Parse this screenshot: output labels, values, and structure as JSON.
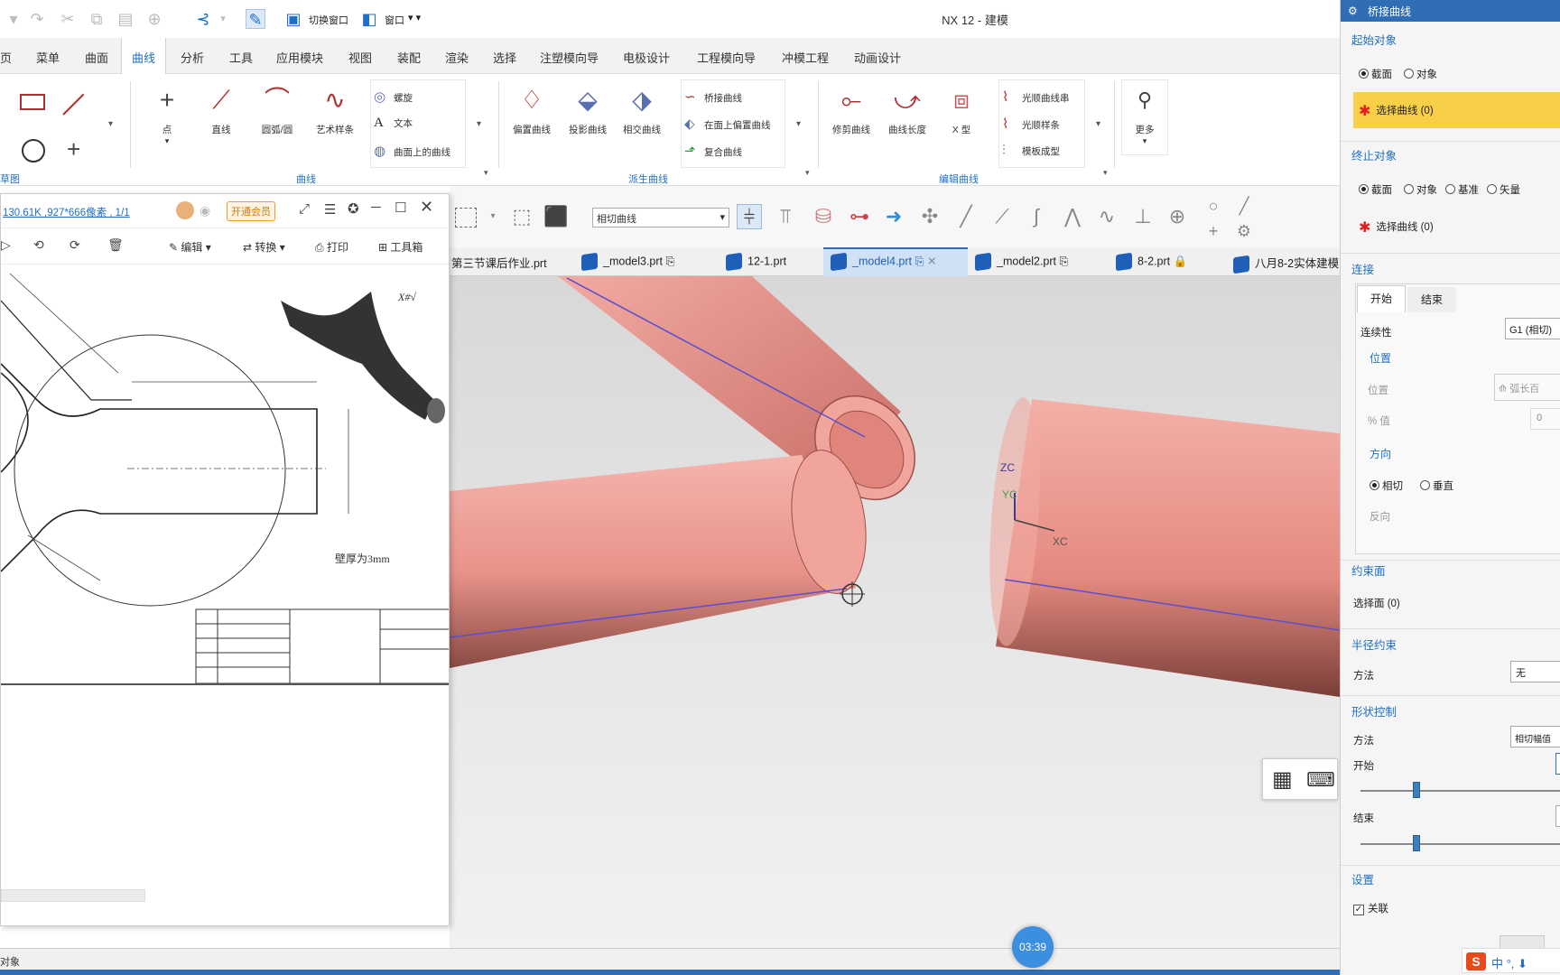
{
  "app": {
    "title": "NX 12 - 建模"
  },
  "quick_access": {
    "switch_window": "切换窗口",
    "window": "窗口"
  },
  "menu_tabs": [
    "页",
    "菜单",
    "曲面",
    "曲线",
    "分析",
    "工具",
    "应用模块",
    "视图",
    "装配",
    "渲染",
    "选择",
    "注塑模向导",
    "电极设计",
    "工程模向导",
    "冲模工程",
    "动画设计"
  ],
  "active_menu_tab": "曲线",
  "ribbon": {
    "group_sketch": "草图",
    "group_curve": "曲线",
    "group_derived": "派生曲线",
    "group_edit": "编辑曲线",
    "buttons": {
      "point": "点",
      "line": "直线",
      "arc": "圆弧/圆",
      "studio_spline": "艺术样条",
      "helix": "螺旋",
      "text": "文本",
      "curve_on_surface": "曲面上的曲线",
      "offset_curve": "偏置曲线",
      "project_curve": "投影曲线",
      "intersect_curve": "相交曲线",
      "bridge_curve": "桥接曲线",
      "offset_in_face": "在面上偏置曲线",
      "composite_curve": "复合曲线",
      "trim_curve": "修剪曲线",
      "curve_length": "曲线长度",
      "x_form": "X 型",
      "smooth_curve_string": "光顺曲线串",
      "smooth_spline": "光顺样条",
      "template_form": "模板成型",
      "more": "更多"
    }
  },
  "selection_filter": {
    "value": "相切曲线"
  },
  "doc_tabs": [
    {
      "label": "第三节课后作业.prt",
      "active": false
    },
    {
      "label": "_model3.prt",
      "active": false
    },
    {
      "label": "12-1.prt",
      "active": false
    },
    {
      "label": "_model4.prt",
      "active": true
    },
    {
      "label": "_model2.prt",
      "active": false
    },
    {
      "label": "8-2.prt",
      "active": false
    },
    {
      "label": "八月8-2实体建模",
      "active": false
    }
  ],
  "viewer": {
    "file_info": "130.61K ,927*666像素 , 1/1",
    "vip_badge": "开通会员",
    "tools": {
      "edit": "编辑",
      "convert": "转换",
      "print": "打印",
      "toolbox": "工具箱"
    },
    "drawing_note": "壁厚为3mm"
  },
  "axis": {
    "zc": "ZC",
    "yc": "YC",
    "xc": "XC"
  },
  "panel": {
    "title": "桥接曲线",
    "start_object": {
      "heading": "起始对象",
      "options": [
        "截面",
        "对象"
      ],
      "selected": "截面",
      "select_prompt": "选择曲线 (0)"
    },
    "end_object": {
      "heading": "终止对象",
      "options": [
        "截面",
        "对象",
        "基准",
        "矢量"
      ],
      "selected": "截面",
      "select_prompt": "选择曲线 (0)"
    },
    "connection": {
      "heading": "连接",
      "tabs": [
        "开始",
        "结束"
      ],
      "continuity_label": "连续性",
      "continuity_value": "G1 (相切)",
      "position_heading": "位置",
      "position_label": "位置",
      "position_value": "弧长百",
      "percent_label": "% 值",
      "percent_value": "0",
      "direction_heading": "方向",
      "direction_options": [
        "相切",
        "垂直"
      ],
      "direction_selected": "相切",
      "reverse_label": "反向"
    },
    "constraint_face": {
      "heading": "约束面",
      "select_label": "选择面 (0)"
    },
    "radius_constraint": {
      "heading": "半径约束",
      "method_label": "方法",
      "method_value": "无"
    },
    "shape_control": {
      "heading": "形状控制",
      "method_label": "方法",
      "method_value": "相切幅值",
      "start_label": "开始",
      "end_label": "结束",
      "start_slider": 0.28,
      "end_slider": 0.28
    },
    "settings": {
      "heading": "设置",
      "associative_label": "关联",
      "associative_checked": true
    }
  },
  "status": {
    "text": "对象"
  },
  "timer": "03:39",
  "colors": {
    "accent": "#1f6fc4",
    "pipe": "#e8938a",
    "panel_header": "#2f6db5",
    "highlight": "#f7d048"
  }
}
